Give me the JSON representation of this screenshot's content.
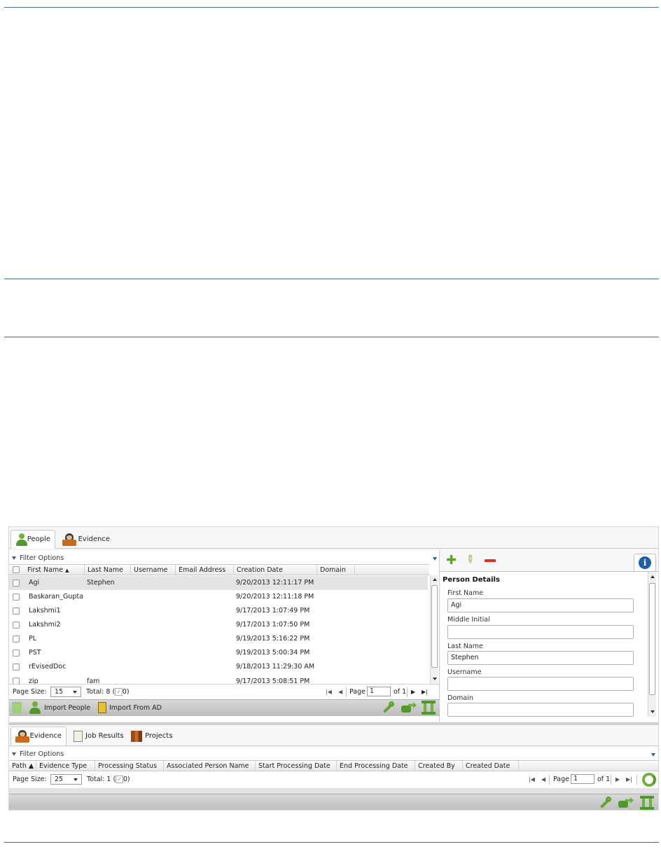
{
  "top_tabs": [
    {
      "label": "People",
      "icon": "person-icon"
    },
    {
      "label": "Evidence",
      "icon": "evidence-icon"
    }
  ],
  "people_grid": {
    "filter_label": "Filter Options",
    "columns": [
      "First Name",
      "Last Name",
      "Username",
      "Email Address",
      "Creation Date",
      "Domain"
    ],
    "sort_indicator": "▲",
    "rows": [
      {
        "first": "Agi",
        "last": "Stephen",
        "date": "9/20/2013 12:11:17 PM"
      },
      {
        "first": "Baskaran_Gupta",
        "last": "",
        "date": "9/20/2013 12:11:18 PM"
      },
      {
        "first": "Lakshmi1",
        "last": "",
        "date": "9/17/2013 1:07:49 PM"
      },
      {
        "first": "Lakshmi2",
        "last": "",
        "date": "9/17/2013 1:07:50 PM"
      },
      {
        "first": "PL",
        "last": "",
        "date": "9/19/2013 5:16:22 PM"
      },
      {
        "first": "PST",
        "last": "",
        "date": "9/19/2013 5:00:34 PM"
      },
      {
        "first": "rEvisedDoc",
        "last": "",
        "date": "9/18/2013 11:29:30 AM"
      },
      {
        "first": "zip",
        "last": "fam",
        "date": "9/17/2013 5:08:51 PM"
      }
    ],
    "pager": {
      "page_size_label": "Page Size:",
      "page_size": "15",
      "total_label": "Total: 8 (",
      "checked_count": "0)",
      "page_label": "Page",
      "page_value": "1",
      "of_label": "of 1"
    },
    "toolbar": {
      "import_people": "Import People",
      "import_ad": "Import From AD"
    }
  },
  "details": {
    "title": "Person Details",
    "fields": [
      {
        "label": "First Name",
        "value": "Agi"
      },
      {
        "label": "Middle Initial",
        "value": ""
      },
      {
        "label": "Last Name",
        "value": "Stephen"
      },
      {
        "label": "Username",
        "value": ""
      },
      {
        "label": "Domain",
        "value": ""
      }
    ]
  },
  "bottom_tabs": [
    {
      "label": "Evidence"
    },
    {
      "label": "Job Results"
    },
    {
      "label": "Projects"
    }
  ],
  "evidence_grid": {
    "filter_label": "Filter Options",
    "columns": [
      "Path ▲",
      "Evidence Type",
      "Processing Status",
      "Associated Person Name",
      "Start Processing Date",
      "End Processing Date",
      "Created By",
      "Created Date"
    ],
    "pager": {
      "page_size_label": "Page Size:",
      "page_size": "25",
      "total_label": "Total: 1 (",
      "checked_count": "0)",
      "page_label": "Page",
      "page_value": "1",
      "of_label": "of 1"
    }
  },
  "colors": {
    "accent_green": "#5da52e",
    "remove_red": "#d9342b",
    "info_blue": "#1f5fa8"
  }
}
